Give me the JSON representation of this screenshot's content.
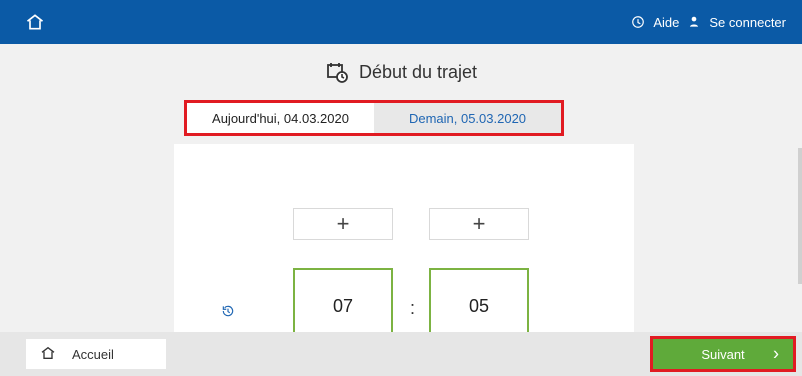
{
  "header": {
    "help_label": "Aide",
    "login_label": "Se connecter"
  },
  "main": {
    "title": "Début du trajet",
    "tabs": [
      {
        "label": "Aujourd'hui, 04.03.2020",
        "active": true
      },
      {
        "label": "Demain, 05.03.2020",
        "active": false
      }
    ],
    "time": {
      "hours": "07",
      "minutes": "05",
      "increment_label": "+",
      "separator": ":"
    }
  },
  "footer": {
    "home_label": "Accueil",
    "next_label": "Suivant"
  },
  "colors": {
    "header_bg": "#0b5aa6",
    "accent_green": "#5faa3a",
    "highlight_red": "#e11b22",
    "tab_link_blue": "#1f66b3"
  },
  "icons": {
    "top_home": "home-icon",
    "help": "help-circle-icon",
    "user": "user-icon",
    "title": "calendar-clock-icon",
    "history": "history-icon",
    "next": "chevron-right-icon"
  }
}
